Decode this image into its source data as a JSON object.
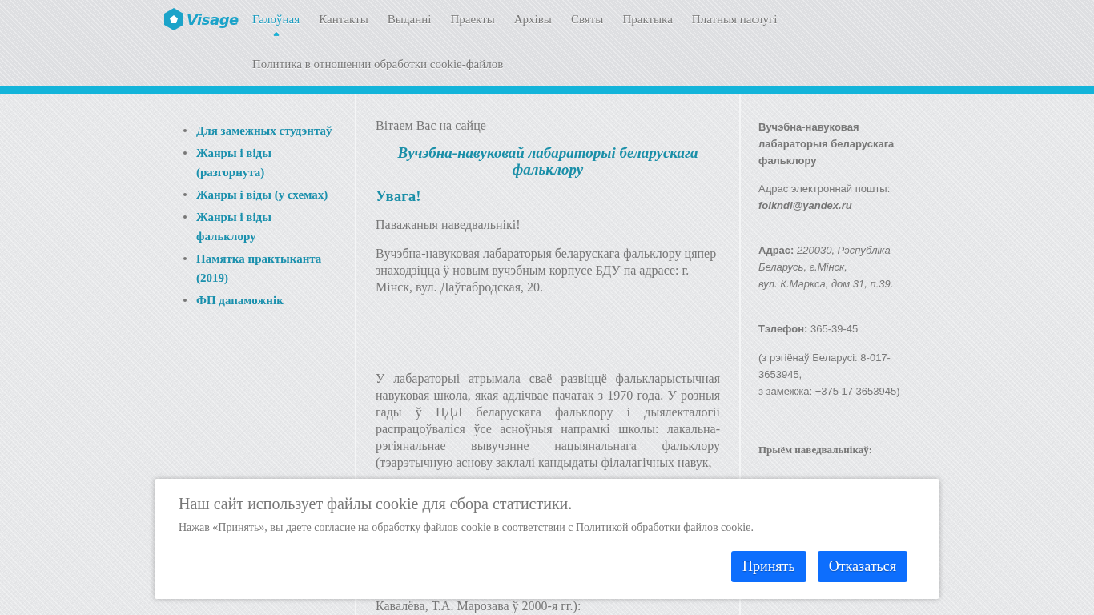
{
  "logo": {
    "text": "Visage"
  },
  "nav": {
    "items": [
      {
        "label": "Галоўная",
        "selected": true
      },
      {
        "label": "Кантакты",
        "selected": false
      },
      {
        "label": "Выданні",
        "selected": false
      },
      {
        "label": "Праекты",
        "selected": false
      },
      {
        "label": "Архівы",
        "selected": false
      },
      {
        "label": "Святы",
        "selected": false
      },
      {
        "label": "Практыка",
        "selected": false
      },
      {
        "label": "Платныя паслугі",
        "selected": false
      },
      {
        "label": "Политика в отношении обработки cookie-файлов",
        "selected": false
      }
    ]
  },
  "sidebar": {
    "items": [
      {
        "label": "Для замежных студэнтаў"
      },
      {
        "label": "Жанры і віды (разгорнута)"
      },
      {
        "label": "Жанры і віды (у схемах)"
      },
      {
        "label": "Жанры і віды фальклору"
      },
      {
        "label": "Памятка практыканта (2019)"
      },
      {
        "label": "ФП дапаможнік"
      }
    ]
  },
  "main": {
    "greeting": "Вітаем Вас на сайце",
    "title": "Вучэбна-навуковай лабараторыі беларускага фальклору",
    "warning": "Увага!",
    "paragraphs": [
      "Паважаныя наведвальнікі!",
      "Вучэбна-навуковая лабараторыя беларускага фальклору цяпер знаходзіцца ў новым вучэбным корпусе БДУ па адрасе: г. Мінск, вул. Даўгабродская, 20.",
      "У лабараторыі атрымала сваё развіццё фалькларыстычная навуковая школа, якая адлічвае пачатак з 1970 года. У розныя гады ў НДЛ беларускага фальклору і дыялекталогіі распрацоўваліся ўсе асноўныя напрамкі школы: лакальна-рэгіянальнае вывучэнне нацыянальнага фальклору (тэарэтычную аснову заклалі кандыдаты філалагічных навук,"
    ],
    "tail": "Кавалёва, Т.А. Марозава ў 2000-я гг.):"
  },
  "contacts": {
    "title": "Вучэбна-навуковая лабараторыя беларускага фальклору",
    "email_label": "Адрас электроннай пошты:",
    "email": "folkndl@yandex.ru",
    "address_label": "Адрас:",
    "address_lines": [
      "220030, Рэспубліка Беларусь, г.Мінск,",
      "вул. К.Маркса, дом 31, п.39."
    ],
    "phone_label": "Тэлефон:",
    "phone": "365-39-45",
    "phone_note_lines": [
      "(з рэгіёнаў Беларусі: 8-017-3653945,",
      "з замежжа: +375 17 3653945)"
    ],
    "reception_label": "Прыём наведвальнікаў:"
  },
  "cookie_banner": {
    "title": "Наш сайт использует файлы cookie для сбора статистики.",
    "text": "Нажав «Принять», вы даете согласие на обработку файлов cookie в соответствии с Политикой обработки файлов cookie.",
    "buttons": [
      "Принять",
      "Отказаться"
    ]
  }
}
